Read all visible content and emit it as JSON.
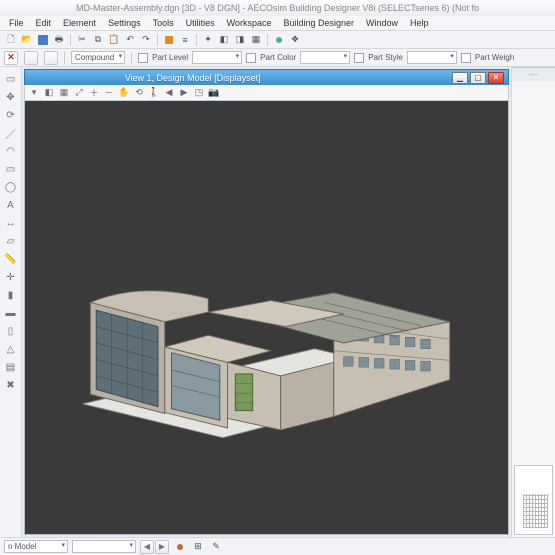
{
  "title": "MD-Master-Assembly.dgn [3D - V8 DGN] - AECOsim Building Designer V8i (SELECTseries 6) (Not fo",
  "menu": [
    "File",
    "Edit",
    "Element",
    "Settings",
    "Tools",
    "Utilities",
    "Workspace",
    "Building Designer",
    "Window",
    "Help"
  ],
  "ribbon2": {
    "compound": "Compound",
    "partLevel": "Part Level",
    "partColor": "Part Color",
    "partStyle": "Part Style",
    "partWeigh": "Part Weigh"
  },
  "view": {
    "title": "View 1, Design Model [Displayset]"
  },
  "status": {
    "model_label": "n Model"
  },
  "winBtns": {
    "min": "▁",
    "max": "▢",
    "close": "✕"
  }
}
